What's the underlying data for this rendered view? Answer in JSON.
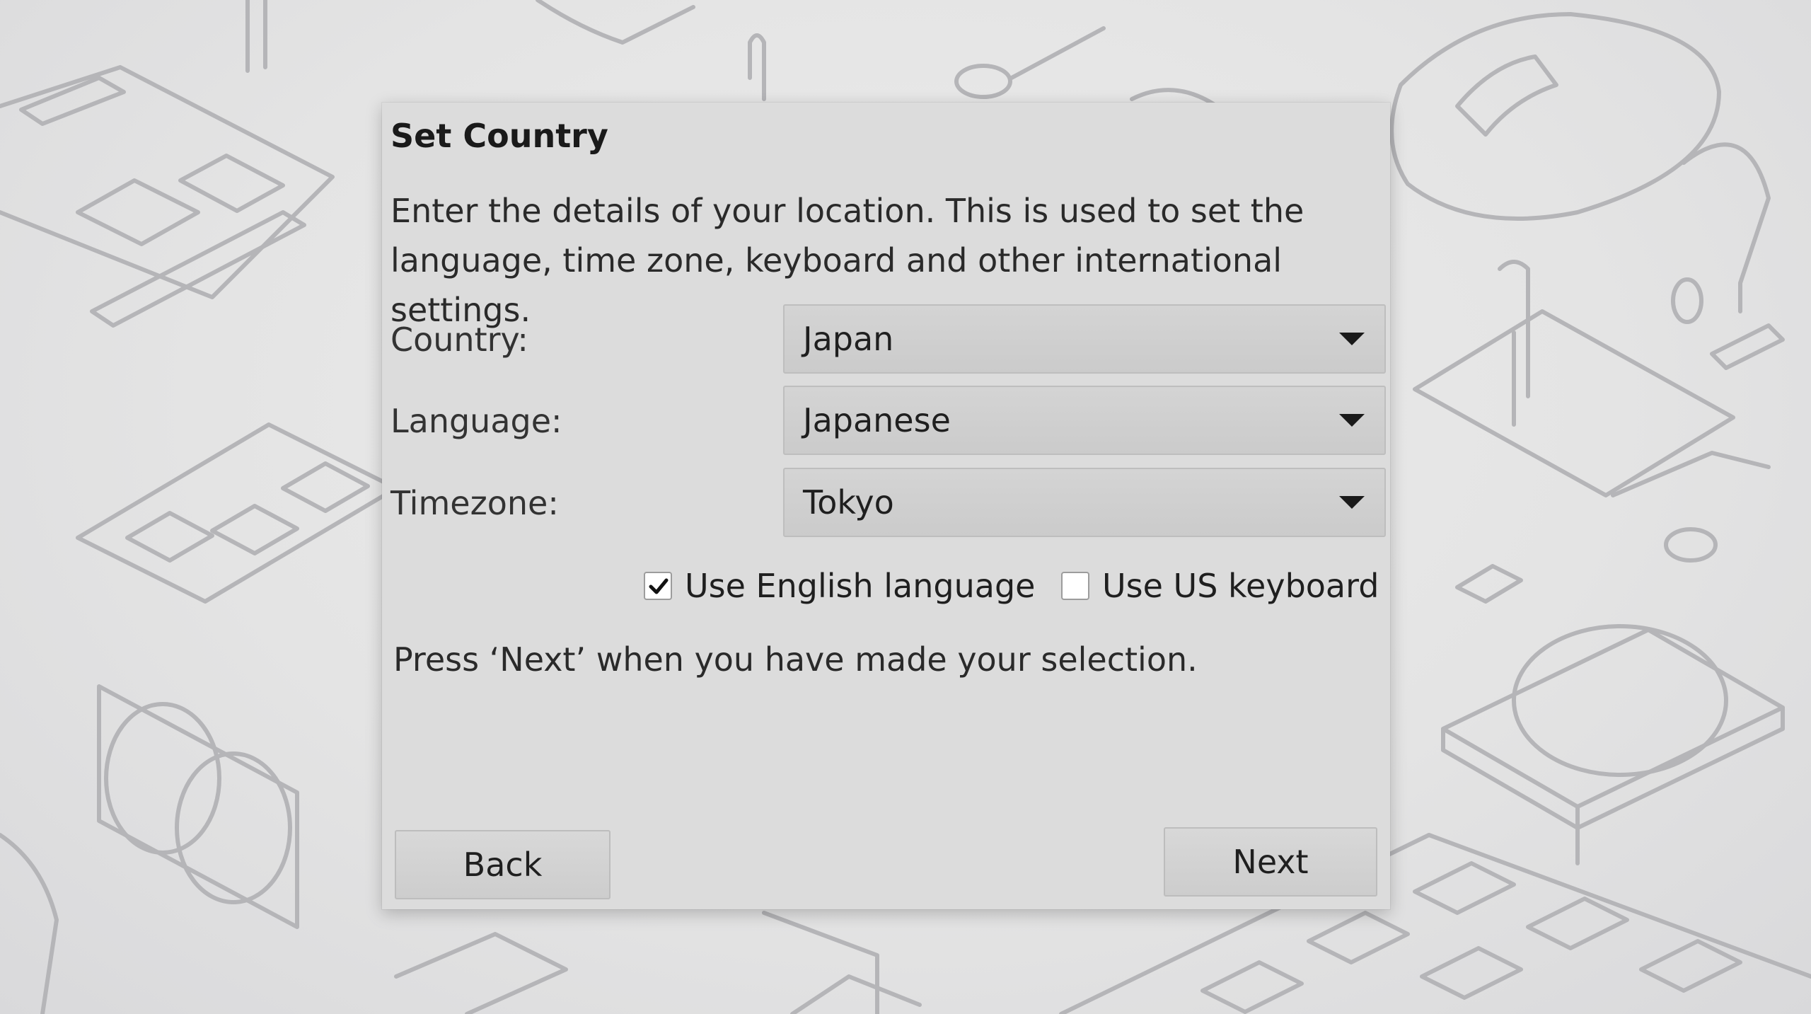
{
  "dialog": {
    "title": "Set Country",
    "intro": "Enter the details of your location. This is used to set the language, time zone, keyboard and other international settings.",
    "hint": "Press ‘Next’ when you have made your selection."
  },
  "fields": {
    "country": {
      "label": "Country:",
      "value": "Japan"
    },
    "language": {
      "label": "Language:",
      "value": "Japanese"
    },
    "timezone": {
      "label": "Timezone:",
      "value": "Tokyo"
    }
  },
  "options": {
    "use_english": {
      "label": "Use English language",
      "checked": true
    },
    "use_us_keyboard": {
      "label": "Use US keyboard",
      "checked": false
    }
  },
  "buttons": {
    "back": "Back",
    "next": "Next"
  },
  "icons": {
    "dropdown": "chevron-down-icon",
    "check": "checkmark-icon"
  }
}
